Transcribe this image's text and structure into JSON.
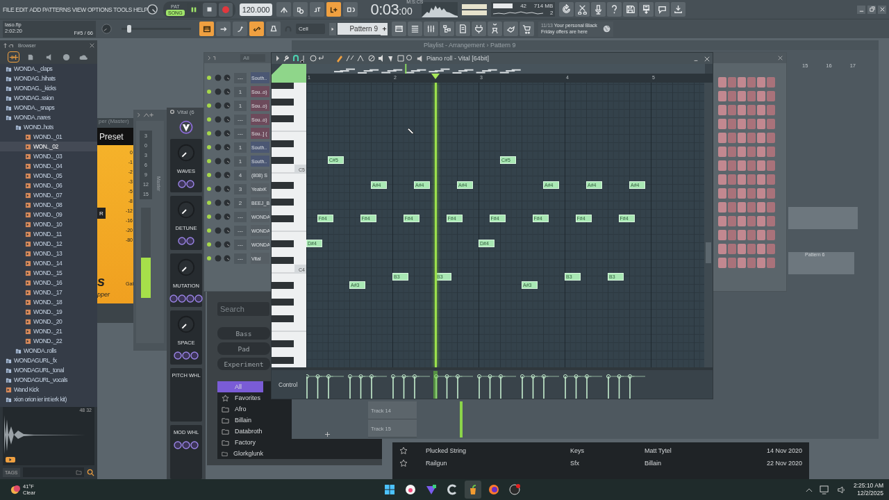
{
  "menu": [
    "FILE",
    "EDIT",
    "ADD",
    "PATTERNS",
    "VIEW",
    "OPTIONS",
    "TOOLS",
    "HELP"
  ],
  "transport": {
    "modes": [
      {
        "label": "PAT",
        "selected": false
      },
      {
        "label": "SONG",
        "selected": true
      }
    ],
    "tempo": "120.000",
    "time": "0:03",
    "time_cs": ":00",
    "time_unit": "M:S:CS"
  },
  "toggles_top": [
    {
      "on": false
    },
    {
      "on": false
    },
    {
      "on": false
    },
    {
      "on": true
    },
    {
      "on": false
    }
  ],
  "toggles_bottom": [
    {
      "on": true
    },
    {
      "on": false
    },
    {
      "on": false
    },
    {
      "on": true
    },
    {
      "on": false
    }
  ],
  "monitor": {
    "voices": "42",
    "memory": "714 MB",
    "polyphony": "2"
  },
  "project": {
    "file": "laso.flp",
    "time": "2:02:20",
    "hint": "F#5 / 66"
  },
  "pitch_slider": {
    "level": 0.08
  },
  "snap": "Cell",
  "pattern": "Pattern 9",
  "news": {
    "counter": "11/13",
    "text": "Your personal Black Friday offers are here"
  },
  "browser": {
    "title": "Browser",
    "tree": [
      {
        "label": "WONDA.._claps",
        "kind": "folder",
        "selected": false
      },
      {
        "label": "WONDAG..hihats",
        "kind": "folder",
        "selected": false
      },
      {
        "label": "WONDAG.._kicks",
        "kind": "folder",
        "selected": false
      },
      {
        "label": "WONDAG..ssion",
        "kind": "folder",
        "selected": false
      },
      {
        "label": "WONDA.._snaps",
        "kind": "folder",
        "selected": false
      },
      {
        "label": "WONDA..nares",
        "kind": "folder",
        "selected": false,
        "children": [
          {
            "label": "WOND..hots",
            "kind": "folder",
            "selected": false,
            "children": [
              {
                "label": "WOND.._01",
                "kind": "file",
                "selected": false
              },
              {
                "label": "WON.._02",
                "kind": "file",
                "selected": true
              },
              {
                "label": "WOND.._03",
                "kind": "file",
                "selected": false
              },
              {
                "label": "WOND.._04",
                "kind": "file",
                "selected": false
              },
              {
                "label": "WOND.._05",
                "kind": "file",
                "selected": false
              },
              {
                "label": "WOND.._06",
                "kind": "file",
                "selected": false
              },
              {
                "label": "WOND.._07",
                "kind": "file",
                "selected": false
              },
              {
                "label": "WOND.._08",
                "kind": "file",
                "selected": false
              },
              {
                "label": "WOND.._09",
                "kind": "file",
                "selected": false
              },
              {
                "label": "WOND.._10",
                "kind": "file",
                "selected": false
              },
              {
                "label": "WOND.._11",
                "kind": "file",
                "selected": false
              },
              {
                "label": "WOND.._12",
                "kind": "file",
                "selected": false
              },
              {
                "label": "WOND.._13",
                "kind": "file",
                "selected": false
              },
              {
                "label": "WOND.._14",
                "kind": "file",
                "selected": false
              },
              {
                "label": "WOND.._15",
                "kind": "file",
                "selected": false
              },
              {
                "label": "WOND.._16",
                "kind": "file",
                "selected": false
              },
              {
                "label": "WOND.._17",
                "kind": "file",
                "selected": false
              },
              {
                "label": "WOND.._18",
                "kind": "file",
                "selected": false
              },
              {
                "label": "WOND.._19",
                "kind": "file",
                "selected": false
              },
              {
                "label": "WOND.._20",
                "kind": "file",
                "selected": false
              },
              {
                "label": "WOND.._21",
                "kind": "file",
                "selected": false
              },
              {
                "label": "WOND.._22",
                "kind": "file",
                "selected": false
              }
            ]
          },
          {
            "label": "WONDA..rolls",
            "kind": "folder",
            "selected": false
          }
        ]
      },
      {
        "label": "WONDAGURL_fx",
        "kind": "folder",
        "selected": false
      },
      {
        "label": "WONDAGURL_tonal",
        "kind": "folder",
        "selected": false
      },
      {
        "label": "WONDAGURL_vocals",
        "kind": "folder",
        "selected": false
      },
      {
        "label": "Wand Kick",
        "kind": "file",
        "selected": false
      },
      {
        "label": "xion orion ier int ierk kit)",
        "kind": "folder",
        "selected": false
      }
    ],
    "sample_rate": "48",
    "bit_depth": "32",
    "tags_label": "TAGS"
  },
  "plugin": {
    "title": "per (Master)",
    "preset": "Preset",
    "button": "R",
    "ticks": [
      "0",
      "-1",
      "-2",
      "-3",
      "-5",
      "-8",
      "-12",
      "-16",
      "-20",
      "-80"
    ],
    "logo": "s",
    "subtitle": "pper",
    "gain": "Gai"
  },
  "mixer": {
    "title": "Master",
    "ticks": [
      "3",
      "0",
      "3",
      "6",
      "9",
      "12",
      "15"
    ],
    "level": 0.45
  },
  "vital": {
    "title": "Vital (6",
    "macros": [
      {
        "label": "WAVES",
        "kind": "knob"
      },
      {
        "label": "DETUNE",
        "kind": "knob"
      },
      {
        "label": "MUTATION",
        "kind": "knob"
      },
      {
        "label": "SPACE",
        "kind": "knob"
      },
      {
        "label": "PITCH WHL",
        "kind": "wheel"
      },
      {
        "label": "MOD WHL",
        "kind": "wheel"
      }
    ]
  },
  "presets": {
    "search_placeholder": "Search",
    "styles": [
      "Bass",
      "Pad",
      "Experiment"
    ],
    "folders": [
      {
        "label": "All",
        "kind": "all",
        "selected": true
      },
      {
        "label": "Favorites",
        "kind": "favorites",
        "selected": false
      },
      {
        "label": "Afro",
        "kind": "folder",
        "selected": false
      },
      {
        "label": "Billain",
        "kind": "folder",
        "selected": false
      },
      {
        "label": "Databroth",
        "kind": "folder",
        "selected": false
      },
      {
        "label": "Factory",
        "kind": "folder",
        "selected": false
      },
      {
        "label": "Glorkglunk",
        "kind": "folder",
        "selected": false
      }
    ],
    "rows": [
      {
        "name": "Plucked String",
        "style": "Keys",
        "author": "Matt Tytel",
        "date": "14 Nov 2020"
      },
      {
        "name": "Railgun",
        "style": "Sfx",
        "author": "Billain",
        "date": "22 Nov 2020"
      }
    ]
  },
  "channel_rack": {
    "filter": "All",
    "channels": [
      {
        "number": "---",
        "name": "South..",
        "color": "#4b5773"
      },
      {
        "number": "1",
        "name": "Sou..o)",
        "color": "#6d4a5b"
      },
      {
        "number": "1",
        "name": "Sou..o)",
        "color": "#6d4a5b"
      },
      {
        "number": "---",
        "name": "Sou..o)",
        "color": "#6d4a5b"
      },
      {
        "number": "---",
        "name": "Sou..] (",
        "color": "#6d4a5b"
      },
      {
        "number": "1",
        "name": "South..",
        "color": "#4b5773"
      },
      {
        "number": "1",
        "name": "South..",
        "color": "#4b5773"
      },
      {
        "number": "4",
        "name": "(808) S",
        "color": "#565e64"
      },
      {
        "number": "3",
        "name": "YeatxK",
        "color": "#565e64"
      },
      {
        "number": "2",
        "name": "BEEJ_B",
        "color": "#565e64"
      },
      {
        "number": "---",
        "name": "WONDA",
        "color": "#565e64"
      },
      {
        "number": "---",
        "name": "WONDA",
        "color": "#565e64"
      },
      {
        "number": "---",
        "name": "WONDA",
        "color": "#565e64"
      },
      {
        "number": "---",
        "name": "Vital",
        "color": "#565e64"
      }
    ]
  },
  "playlist": {
    "title": "Playlist - Arrangement › Pattern 9",
    "bars": [
      "15",
      "16",
      "17"
    ],
    "tracks": [
      "Track 14",
      "Track 15"
    ],
    "clip": "Pattern 6"
  },
  "piano_roll": {
    "title": "Piano roll - Vital [64bit]",
    "bars": [
      "1",
      "2",
      "3",
      "4",
      "5"
    ],
    "key_labels": [
      "C5",
      "C4"
    ],
    "playhead": {
      "level": 0.324
    },
    "control_label": "Control",
    "note_groups": [
      {
        "notes": [
          {
            "label": "D#4"
          },
          {
            "label": "F#4"
          },
          {
            "label": "C#5"
          }
        ]
      },
      {
        "notes": [
          {
            "label": "A#3"
          },
          {
            "label": "F#4"
          },
          {
            "label": "A#4"
          }
        ]
      },
      {
        "notes": [
          {
            "label": "B3"
          },
          {
            "label": "F#4"
          },
          {
            "label": "A#4"
          }
        ]
      },
      {
        "notes": [
          {
            "label": "B3"
          },
          {
            "label": "F#4"
          },
          {
            "label": "A#4"
          }
        ]
      },
      {
        "notes": [
          {
            "label": "D#4"
          },
          {
            "label": "F#4"
          },
          {
            "label": "C#5"
          }
        ]
      },
      {
        "notes": [
          {
            "label": "A#3"
          },
          {
            "label": "F#4"
          },
          {
            "label": "A#4"
          }
        ]
      },
      {
        "notes": [
          {
            "label": "B3"
          },
          {
            "label": "F#4"
          },
          {
            "label": "A#4"
          }
        ]
      },
      {
        "notes": [
          {
            "label": "B3"
          },
          {
            "label": "F#4"
          },
          {
            "label": "A#4"
          }
        ]
      }
    ]
  },
  "taskbar": {
    "temperature": "41°F",
    "weather": "Clear",
    "time": "2:25:10 AM",
    "date": "12/2/2025",
    "apps": [
      {
        "kind": "start",
        "selected": false
      },
      {
        "kind": "music",
        "selected": false
      },
      {
        "kind": "vpn",
        "selected": false
      },
      {
        "kind": "cleaner",
        "selected": false
      },
      {
        "kind": "daw",
        "selected": true
      },
      {
        "kind": "browser",
        "selected": false
      },
      {
        "kind": "recorder",
        "selected": false
      }
    ]
  }
}
